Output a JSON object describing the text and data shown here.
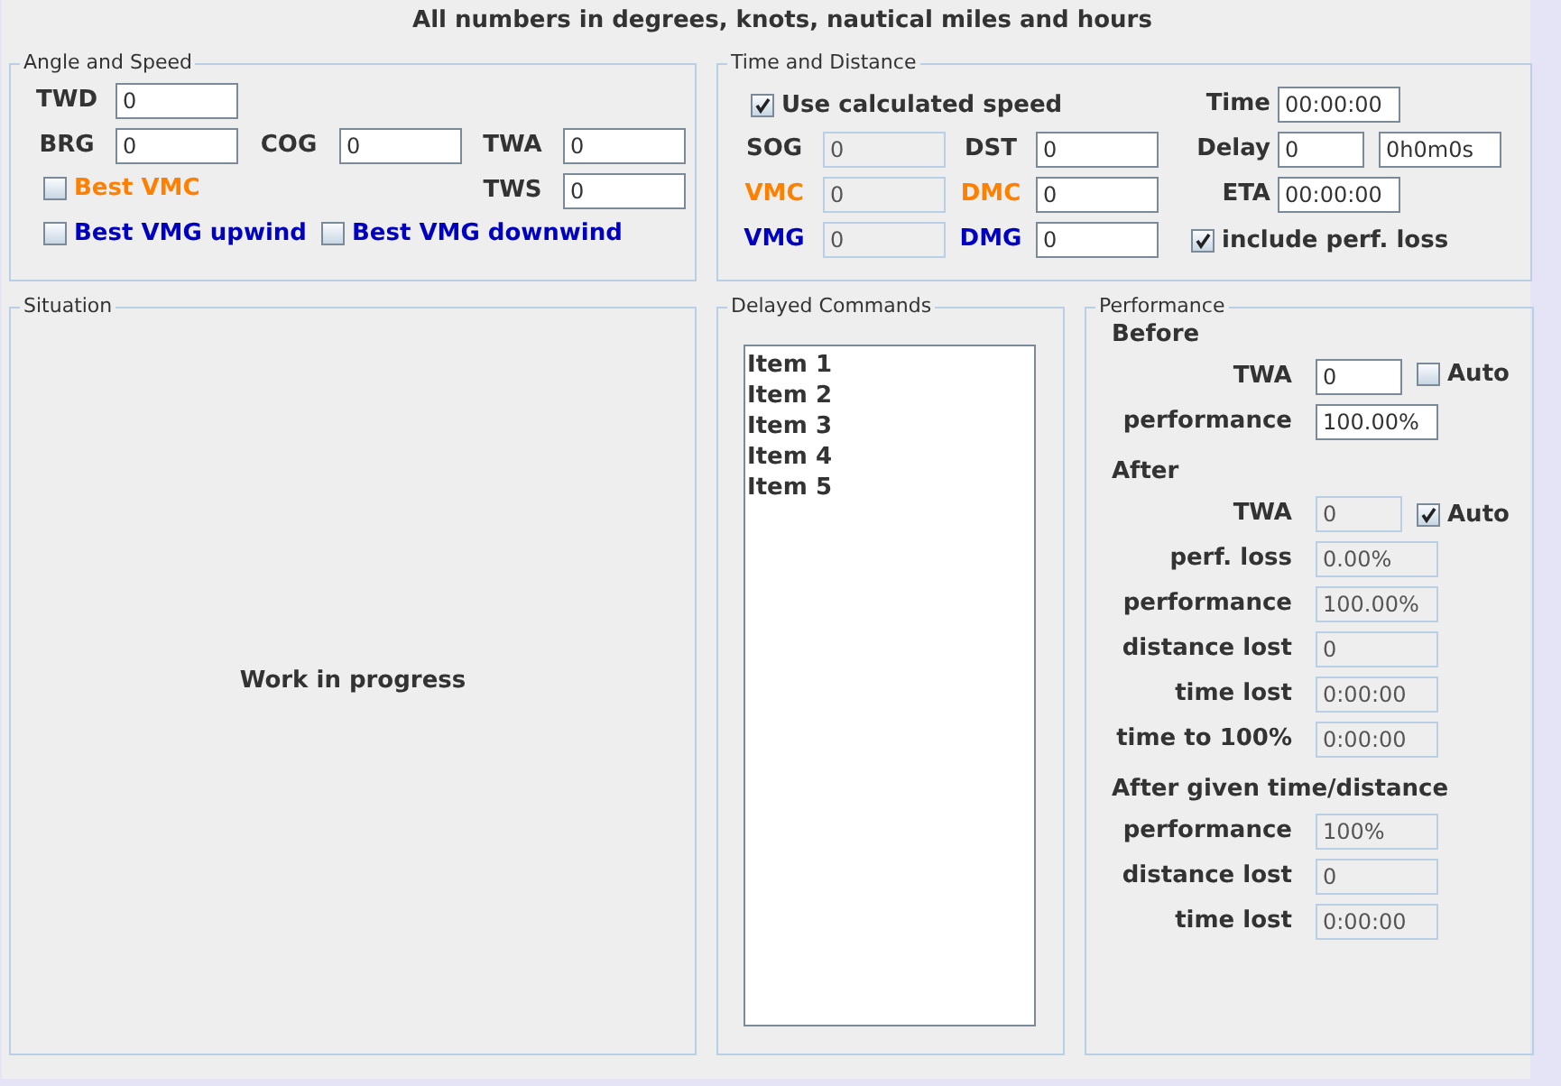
{
  "title": "All numbers in degrees, knots, nautical miles and hours",
  "angle_and_speed": {
    "title": "Angle and Speed",
    "fields": [
      {
        "label": "TWD",
        "value": "0"
      },
      {
        "label": "BRG",
        "value": "0"
      },
      {
        "label": "COG",
        "value": "0"
      },
      {
        "label": "TWA",
        "value": "0"
      },
      {
        "label": "TWS",
        "value": "0"
      }
    ],
    "checkboxes": [
      {
        "label": "Best VMC",
        "checked": false,
        "color": "#ff8000"
      },
      {
        "label": "Best VMG upwind",
        "checked": false,
        "color": "#0000c0"
      },
      {
        "label": "Best VMG downwind",
        "checked": false,
        "color": "#0000c0"
      }
    ]
  },
  "time_and_distance": {
    "title": "Time and Distance",
    "items": [
      {
        "kind": "checkbox",
        "label": "Use calculated speed",
        "checked": true
      },
      {
        "kind": "field",
        "label": "Time",
        "value": "00:00:00",
        "disabled": false
      },
      {
        "kind": "field",
        "label": "SOG",
        "value": "0",
        "disabled": true
      },
      {
        "kind": "field",
        "label": "DST",
        "value": "0",
        "disabled": false
      },
      {
        "kind": "field",
        "label": "Delay",
        "value": "0",
        "formatted": "0h0m0s",
        "disabled": false
      },
      {
        "kind": "field",
        "label": "VMC",
        "value": "0",
        "disabled": true,
        "color": "#ff8000"
      },
      {
        "kind": "field",
        "label": "DMC",
        "value": "0",
        "disabled": false,
        "color": "#ff8000"
      },
      {
        "kind": "field",
        "label": "ETA",
        "value": "00:00:00",
        "disabled": false
      },
      {
        "kind": "field",
        "label": "VMG",
        "value": "0",
        "disabled": true,
        "color": "#0000c0"
      },
      {
        "kind": "field",
        "label": "DMG",
        "value": "0",
        "disabled": false,
        "color": "#0000c0"
      },
      {
        "kind": "checkbox",
        "label": "include perf. loss",
        "checked": true
      }
    ]
  },
  "situation": {
    "title": "Situation",
    "message": "Work in progress"
  },
  "delayed_commands": {
    "title": "Delayed Commands",
    "items": [
      "Item 1",
      "Item 2",
      "Item 3",
      "Item 4",
      "Item 5"
    ]
  },
  "performance": {
    "title": "Performance",
    "sections": [
      {
        "heading": "Before",
        "rows": [
          {
            "label": "TWA",
            "value": "0",
            "disabled": false,
            "auto": {
              "label": "Auto",
              "checked": false
            }
          },
          {
            "label": "performance",
            "value": "100.00%",
            "disabled": false
          }
        ]
      },
      {
        "heading": "After",
        "rows": [
          {
            "label": "TWA",
            "value": "0",
            "disabled": true,
            "auto": {
              "label": "Auto",
              "checked": true
            }
          },
          {
            "label": "perf. loss",
            "value": "0.00%",
            "disabled": true
          },
          {
            "label": "performance",
            "value": "100.00%",
            "disabled": true
          },
          {
            "label": "distance lost",
            "value": "0",
            "disabled": true
          },
          {
            "label": "time lost",
            "value": "0:00:00",
            "disabled": true
          },
          {
            "label": "time to 100%",
            "value": "0:00:00",
            "disabled": true
          }
        ]
      },
      {
        "heading": "After given time/distance",
        "rows": [
          {
            "label": "performance",
            "value": "100%",
            "disabled": true
          },
          {
            "label": "distance lost",
            "value": "0",
            "disabled": true
          },
          {
            "label": "time lost",
            "value": "0:00:00",
            "disabled": true
          }
        ]
      }
    ]
  }
}
